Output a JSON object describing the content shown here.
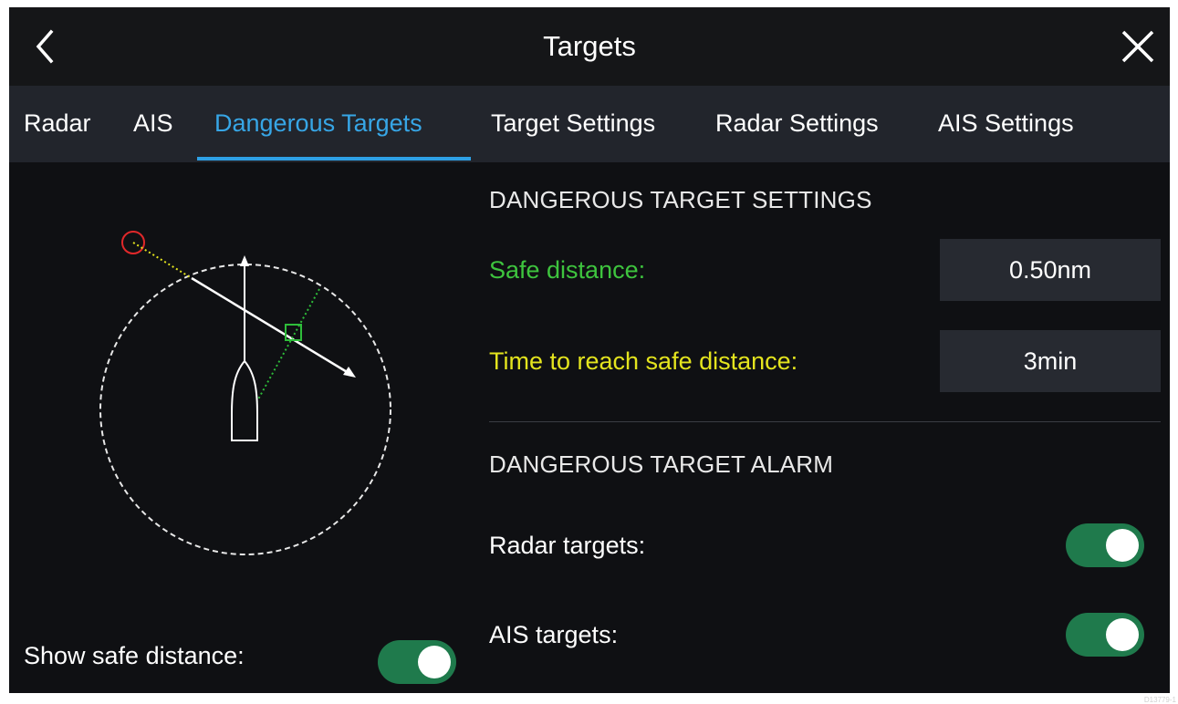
{
  "header": {
    "title": "Targets",
    "back_icon": "chevron-left-icon",
    "close_icon": "close-icon"
  },
  "tabs": [
    {
      "label": "Radar",
      "active": false
    },
    {
      "label": "AIS",
      "active": false
    },
    {
      "label": "Dangerous Targets",
      "active": true
    },
    {
      "label": "Target Settings",
      "active": false
    },
    {
      "label": "Radar Settings",
      "active": false
    },
    {
      "label": "AIS Settings",
      "active": false
    }
  ],
  "settings": {
    "heading": "DANGEROUS TARGET SETTINGS",
    "safe_distance_label": "Safe distance:",
    "safe_distance_value": "0.50nm",
    "time_label": "Time to reach safe distance:",
    "time_value": "3min"
  },
  "alarm": {
    "heading": "DANGEROUS TARGET ALARM",
    "radar_label": "Radar targets:",
    "radar_on": true,
    "ais_label": "AIS targets:",
    "ais_on": true
  },
  "show_safe_distance": {
    "label": "Show safe distance:",
    "on": true
  },
  "doc_id": "D13779-1",
  "colors": {
    "accent": "#2ea0e5",
    "toggle_on": "#1f7a4c",
    "safe_distance_text": "#3ec43e",
    "time_text": "#e4e41e",
    "target_circle": "#e0282a",
    "cpa_marker": "#2ebd3a"
  }
}
